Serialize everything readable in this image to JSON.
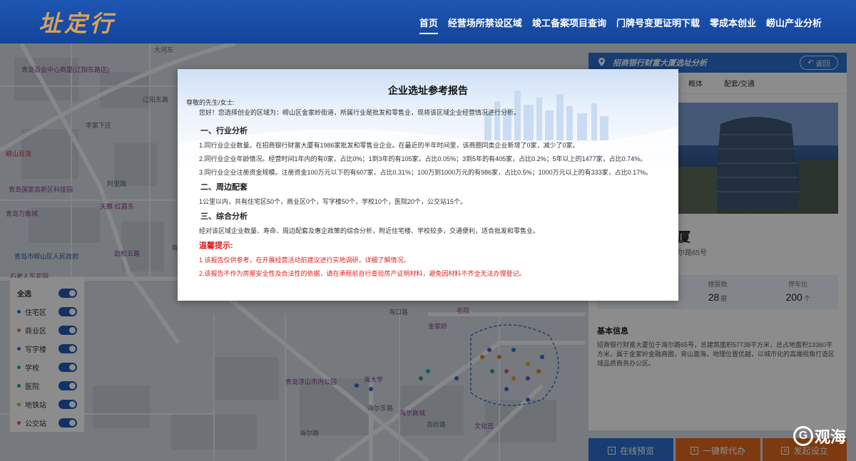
{
  "header": {
    "logo": "址定行",
    "nav": [
      "首页",
      "经营场所禁设区域",
      "竣工备案项目查询",
      "门牌号变更证明下载",
      "零成本创业",
      "崂山产业分析"
    ]
  },
  "map_labels": {
    "l1": "大河东",
    "l2": "青岛百会中心商厦(辽阳东路店)",
    "l3": "辽阳东路",
    "l4": "崂山百货",
    "l5": "李家下庄",
    "l6": "青岛国家高新区科技园",
    "l7": "青岛万象城",
    "l8": "阿里路",
    "l9": "天麒·红霞东",
    "l10": "劲松五路",
    "l11": "青岛市崂山区人民政府",
    "l12": "石老人东花园",
    "l13": "海尔路",
    "l14": "名院",
    "l15": "海口路",
    "l16": "金家岭",
    "l17": "青岛浮山市内公园",
    "l18": "海大学",
    "l19": "海尔路",
    "l20": "海尔东路",
    "l21": "海尔商城",
    "l22": "苗岭路",
    "l23": "文化宫"
  },
  "legend": {
    "items": [
      {
        "label": "全选",
        "color": ""
      },
      {
        "label": "住宅区",
        "color": "#2f6fd1"
      },
      {
        "label": "商业区",
        "color": "#e07e2b"
      },
      {
        "label": "写字楼",
        "color": "#7a4fd0"
      },
      {
        "label": "学校",
        "color": "#1aa6c9"
      },
      {
        "label": "医院",
        "color": "#2aa85a"
      },
      {
        "label": "地铁站",
        "color": "#e0a82b"
      },
      {
        "label": "公交站",
        "color": "#d14fa7"
      }
    ]
  },
  "panel": {
    "title": "招商银行财富大厦选址分析",
    "back": "返回",
    "tabs": [
      "概体",
      "配套/交通"
    ],
    "name_visible": "厦",
    "addr_visible": "尔路65号",
    "stats": [
      {
        "key": "",
        "value": "",
        "unit": ""
      },
      {
        "key": "楼层数",
        "value": "28",
        "unit": "层"
      },
      {
        "key": "停车位",
        "value": "200",
        "unit": "个"
      }
    ],
    "info_title": "基本信息",
    "info": "招商银行财富大厦位于海尔路65号，总建筑面积57738平方米，总占地面积13360平方米，属于金家岭金融商圈，背山面海，地理位置优越，以城市化的高端视角打造区域品质商务办公区。"
  },
  "actions": {
    "preview": "在线预览",
    "help": "一键帮代办",
    "setup": "发起设立"
  },
  "watermark": "观海",
  "modal": {
    "title": "企业选址参考报告",
    "greeting": "尊敬的先生/女士:",
    "intro": "您好！您选择创业的区域为：崂山区金家岭街道，所属行业是批发和零售业，现将该区域企业经营情况进行分析。",
    "s1": "一、行业分析",
    "s1_l1": "1.同行业企业数量。在招商银行财富大厦有1986家批发和零售业企业。在最近的半年时间里，该商圈同类企业新增了0家，减少了0家。",
    "s1_l2": "2.同行业企业年龄情况。经营时间1年内的有0家，占比0%；1到3年的有105家，占比0.05%；3到5年的有405家，占比0.2%；5年以上的1477家，占比0.74%。",
    "s1_l3": "3.同行业企业注册资金规模。注册资金100万元以下的有607家，占比0.31%；100万到1000万元的有986家，占比0.5%；1000万元以上的有333家，占比0.17%。",
    "s2": "二、周边配套",
    "s2_l1": "1公里以内，共有住宅区50个，商业区0个，写字楼50个，学校10个，医院20个，公交站15个。",
    "s3": "三、综合分析",
    "s3_l1": "经对该区域企业数量、寿命、周边配套及惠企政策的综合分析，附近住宅楼、学校较多，交通便利，适合批发和零售业。",
    "tip": "温馨提示:",
    "tip1": "1.该报告仅供参考，在开展经营活动前建议进行实地调研，详细了解情况。",
    "tip2": "2.该报告不作为房屋安全性及合法性的依据，请在承租前自行查验房产证明材料，避免因材料不齐全无法办理登记。"
  }
}
